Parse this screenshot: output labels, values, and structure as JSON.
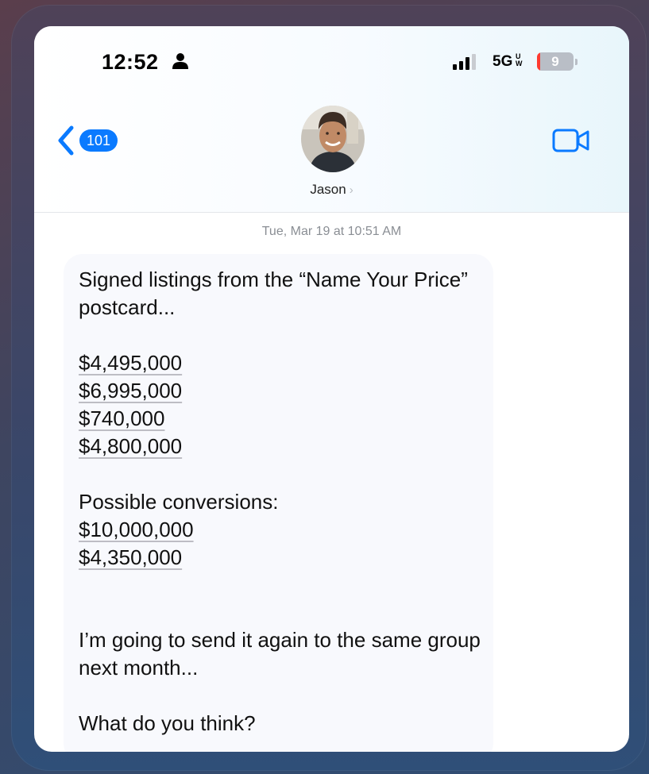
{
  "status_bar": {
    "time": "12:52",
    "network": "5G",
    "network_sub": "UW",
    "battery": "9",
    "battery_level_percent": 9,
    "icons": [
      "person-icon",
      "cellular-signal-icon",
      "battery-icon"
    ]
  },
  "nav": {
    "back_badge": "101",
    "contact_name": "Jason",
    "contact_chevron": "›",
    "icons": [
      "back-chevron-icon",
      "video-call-icon",
      "contact-avatar"
    ]
  },
  "thread": {
    "timestamp": "Tue, Mar 19 at 10:51 AM",
    "message": {
      "intro": "Signed listings from the “Name Your Price” postcard...",
      "listings": [
        "$4,495,000",
        "$6,995,000",
        "$740,000",
        "$4,800,000"
      ],
      "conversions_label": "Possible conversions:",
      "conversions": [
        "$10,000,000",
        "$4,350,000"
      ],
      "followup": "I’m going to send it again to the same group next month...",
      "question": "What do you think?"
    }
  },
  "colors": {
    "accent": "#0a7aff",
    "battery_low": "#ff3b30",
    "bubble": "#f8f9fd"
  }
}
